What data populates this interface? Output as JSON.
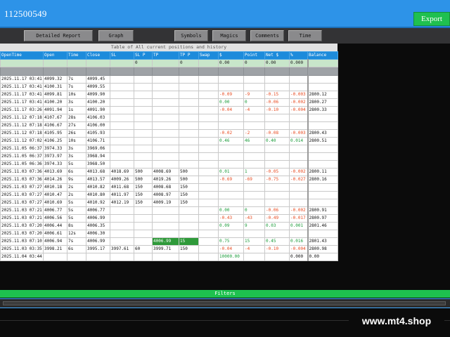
{
  "header": {
    "account": "112500549",
    "export_label": "Export"
  },
  "toolbar": {
    "detailed_report": "Detailed Report",
    "graph": "Graph",
    "symbols": "Symbols",
    "magics": "Magics",
    "comments": "Comments",
    "time": "Time"
  },
  "table": {
    "caption": "Table of All current positions and history",
    "columns": [
      "OpenTime",
      "Open",
      "Time",
      "Close",
      "SL",
      "SL P",
      "TP",
      "TP P",
      "Swap",
      "$",
      "Point",
      "Net $",
      "%",
      "Balance"
    ],
    "summary": [
      "",
      "",
      "",
      "",
      "",
      "0",
      "",
      "0",
      "",
      "0.00",
      "0",
      "0.00",
      "0.000",
      ""
    ],
    "rows": [
      [
        "2025.11.17 03:41:4",
        "4099.32",
        "7s",
        "4099.45",
        "",
        "",
        "",
        "",
        "",
        "",
        "",
        "",
        "",
        ""
      ],
      [
        "2025.11.17 03:41:4",
        "4100.31",
        "7s",
        "4099.55",
        "",
        "",
        "",
        "",
        "",
        "",
        "",
        "",
        "",
        ""
      ],
      [
        "2025.11.17 03:41:3",
        "4099.81",
        "10s",
        "4099.90",
        "",
        "",
        "",
        "",
        "",
        "-0.09",
        "-9",
        "-0.15",
        "-0.003",
        "2800.12"
      ],
      [
        "2025.11.17 03:41:3",
        "4100.20",
        "3s",
        "4100.20",
        "",
        "",
        "",
        "",
        "",
        "0.00",
        "0",
        "-0.06",
        "-0.002",
        "2800.27"
      ],
      [
        "2025.11.17 03:26:4",
        "4091.94",
        "1s",
        "4091.90",
        "",
        "",
        "",
        "",
        "",
        "-0.04",
        "-4",
        "-0.10",
        "-0.004",
        "2800.33"
      ],
      [
        "2025.11.12 07:18:3",
        "4107.67",
        "28s",
        "4106.03",
        "",
        "",
        "",
        "",
        "",
        "",
        "",
        "",
        "",
        ""
      ],
      [
        "2025.11.12 07:18:2",
        "4106.67",
        "27s",
        "4106.00",
        "",
        "",
        "",
        "",
        "",
        "",
        "",
        "",
        "",
        ""
      ],
      [
        "2025.11.12 07:18:1",
        "4105.95",
        "26s",
        "4105.93",
        "",
        "",
        "",
        "",
        "",
        "-0.02",
        "-2",
        "-0.08",
        "-0.003",
        "2800.43"
      ],
      [
        "2025.11.12 07:02:4",
        "4106.25",
        "10s",
        "4106.71",
        "",
        "",
        "",
        "",
        "",
        "0.46",
        "46",
        "0.40",
        "0.014",
        "2800.51"
      ],
      [
        "2025.11.05 06:37:4",
        "3974.33",
        "3s",
        "3969.06",
        "",
        "",
        "",
        "",
        "",
        "",
        "",
        "",
        "",
        ""
      ],
      [
        "2025.11.05 06:37:3",
        "3973.97",
        "3s",
        "3968.94",
        "",
        "",
        "",
        "",
        "",
        "",
        "",
        "",
        "",
        ""
      ],
      [
        "2025.11.05 06:36:5",
        "3974.33",
        "5s",
        "3968.50",
        "",
        "",
        "",
        "",
        "",
        "",
        "",
        "",
        "",
        ""
      ],
      [
        "2025.11.03 07:36:5",
        "4013.69",
        "6s",
        "4013.68",
        "4018.69",
        "500",
        "4008.69",
        "500",
        "",
        "0.01",
        "1",
        "-0.05",
        "-0.002",
        "2800.11"
      ],
      [
        "2025.11.03 07:36:4",
        "4014.26",
        "9s",
        "4013.57",
        "4009.26",
        "500",
        "4019.26",
        "500",
        "",
        "-0.69",
        "-69",
        "-0.75",
        "-0.027",
        "2800.16"
      ],
      [
        "2025.11.03 07:27:5",
        "4010.18",
        "2s",
        "4010.82",
        "4011.68",
        "150",
        "4008.68",
        "150",
        "",
        "",
        "",
        "",
        "",
        ""
      ],
      [
        "2025.11.03 07:27:5",
        "4010.47",
        "2s",
        "4010.80",
        "4011.97",
        "150",
        "4008.97",
        "150",
        "",
        "",
        "",
        "",
        "",
        ""
      ],
      [
        "2025.11.03 07:27:5",
        "4010.69",
        "5s",
        "4010.92",
        "4012.19",
        "150",
        "4009.19",
        "150",
        "",
        "",
        "",
        "",
        "",
        ""
      ],
      [
        "2025.11.03 07:21:0",
        "4006.77",
        "5s",
        "4006.77",
        "",
        "",
        "",
        "",
        "",
        "0.00",
        "0",
        "-0.06",
        "-0.002",
        "2800.91"
      ],
      [
        "2025.11.03 07:21:0",
        "4006.56",
        "5s",
        "4006.99",
        "",
        "",
        "",
        "",
        "",
        "-0.43",
        "-43",
        "-0.49",
        "-0.017",
        "2800.97"
      ],
      [
        "2025.11.03 07:20:4",
        "4006.44",
        "8s",
        "4006.35",
        "",
        "",
        "",
        "",
        "",
        "0.09",
        "9",
        "0.03",
        "0.001",
        "2801.46"
      ],
      [
        "2025.11.03 07:20:4",
        "4006.61",
        "12s",
        "4006.30",
        "",
        "",
        "",
        "",
        "",
        "",
        "",
        "",
        "",
        ""
      ],
      [
        "2025.11.03 07:10:2",
        "4006.94",
        "7s",
        "4006.99",
        "",
        "",
        "4006.99",
        "15",
        "",
        "0.75",
        "15",
        "0.45",
        "0.016",
        "2801.43"
      ],
      [
        "2025.11.03 03:35:4",
        "3998.21",
        "6s",
        "3995.17",
        "3997.61",
        "60",
        "3999.71",
        "150",
        "",
        "-0.04",
        "-4",
        "-0.10",
        "-0.004",
        "2800.98"
      ],
      [
        "2025.11.04 03:44:3",
        "",
        "",
        "",
        "",
        "",
        "",
        "",
        "",
        "10000.00",
        "",
        "",
        "0.000",
        "0.00"
      ]
    ],
    "highlight": {
      "row": 21,
      "cols": [
        6,
        7
      ]
    }
  },
  "footer": {
    "filters_label": "Filters"
  },
  "watermark": "www.mt4.shop"
}
